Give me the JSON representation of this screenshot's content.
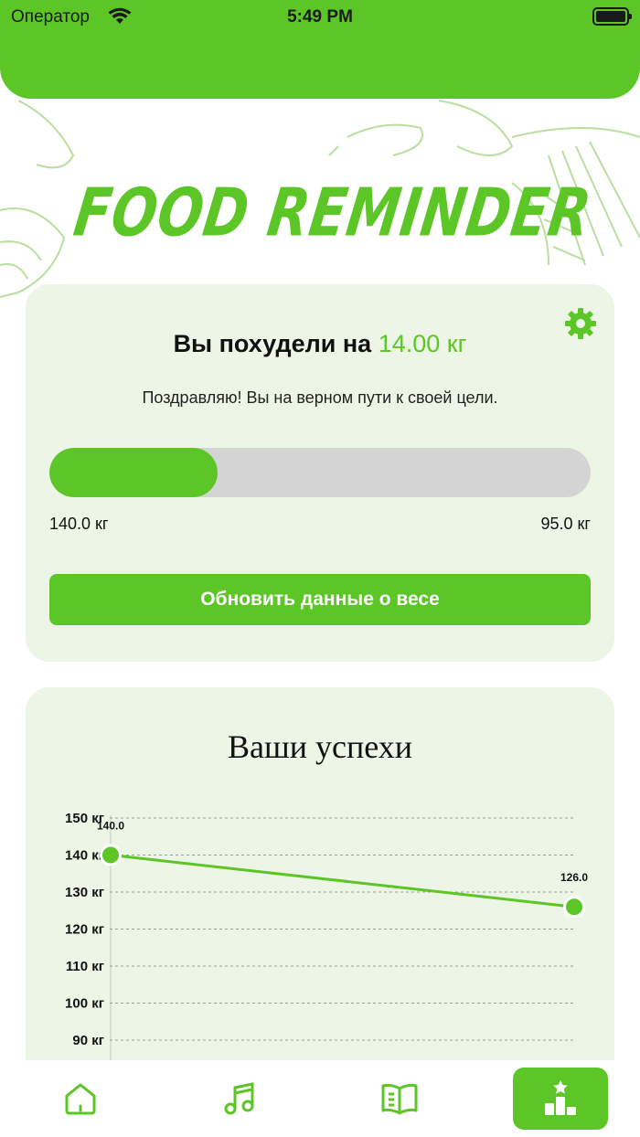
{
  "status_bar": {
    "carrier": "Оператор",
    "time": "5:49 PM"
  },
  "app": {
    "logo_text": "FOOD REMINDER"
  },
  "progress_card": {
    "headline_prefix": "Вы похудели на",
    "headline_value": "14.00 кг",
    "subtitle": "Поздравляю! Вы на верном пути к своей цели.",
    "progress_fraction": 0.311,
    "start_label": "140.0 кг",
    "goal_label": "95.0 кг",
    "update_button": "Обновить данные о весе"
  },
  "chart_card": {
    "title": "Ваши успехи"
  },
  "chart_data": {
    "type": "line",
    "y_unit": "кг",
    "y_ticks": [
      150,
      140,
      130,
      120,
      110,
      100,
      90
    ],
    "ylim": [
      90,
      150
    ],
    "points": [
      {
        "label": "140.0",
        "y": 140.0
      },
      {
        "label": "126.0",
        "y": 126.0
      }
    ],
    "grid": true
  },
  "tabbar": {
    "items": [
      {
        "name": "home",
        "icon": "home-icon",
        "active": false
      },
      {
        "name": "music",
        "icon": "music-note-icon",
        "active": false
      },
      {
        "name": "recipes",
        "icon": "book-icon",
        "active": false
      },
      {
        "name": "progress",
        "icon": "podium-icon",
        "active": true
      }
    ]
  },
  "colors": {
    "accent": "#5cc626",
    "card_bg": "#edf6e6",
    "track": "#d4d4d4"
  }
}
